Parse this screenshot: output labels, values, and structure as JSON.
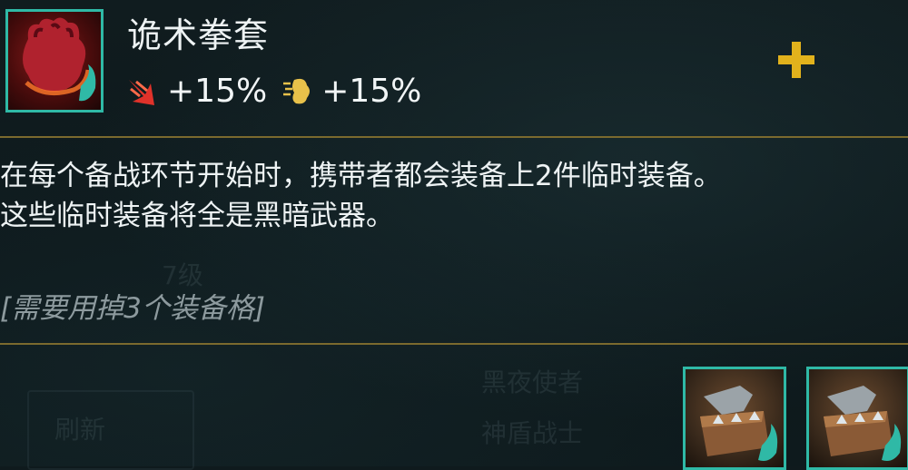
{
  "item": {
    "name": "诡术拳套",
    "icon": "thiefs-gloves-icon",
    "stats": [
      {
        "icon": "attack-speed-icon",
        "value": "+15%"
      },
      {
        "icon": "crit-chance-icon",
        "value": "+15%"
      }
    ],
    "description_lines": [
      "在每个备战环节开始时，携带者都会装备上2件临时装备。",
      "这些临时装备将全是黑暗武器。"
    ],
    "requirement": "[需要用掉3个装备格]",
    "recipe": [
      {
        "icon": "sparring-gloves-icon"
      },
      {
        "icon": "sparring-gloves-icon"
      }
    ],
    "recipe_operator": "plus-icon"
  },
  "colors": {
    "border_teal": "#2fb9a6",
    "divider_gold": "#7b6a2e",
    "attack_speed_red": "#e0322a",
    "crit_gold": "#e8c14a",
    "plus_gold": "#e2b21c"
  },
  "background": {
    "ghost_texts": [
      "7级",
      "刷新",
      "黑夜使者",
      "神盾战士"
    ]
  }
}
